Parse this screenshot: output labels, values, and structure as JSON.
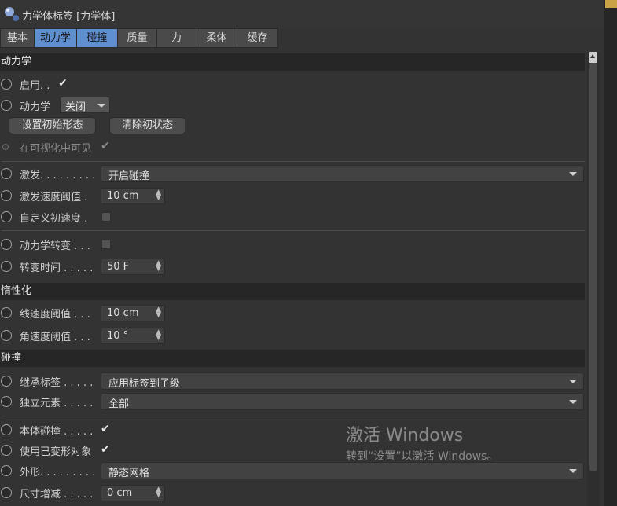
{
  "window": {
    "title": "力学体标签 [力学体]"
  },
  "tabs": [
    {
      "label": "基本",
      "active": false
    },
    {
      "label": "动力学",
      "active": true
    },
    {
      "label": "碰撞",
      "active": true
    },
    {
      "label": "质量",
      "active": false
    },
    {
      "label": "力",
      "active": false
    },
    {
      "label": "柔体",
      "active": false
    },
    {
      "label": "缓存",
      "active": false
    }
  ],
  "sections": {
    "dynamics": "动力学",
    "inertia": "惰性化",
    "collision": "碰撞"
  },
  "dynamics": {
    "enable_label": "启用. .",
    "enable_checked": true,
    "dynamics_label": "动力学",
    "dynamics_value": "关闭",
    "set_initial_button": "设置初始形态",
    "clear_initial_button": "清除初状态",
    "visible_label": "在可视化中可见",
    "visible_checked": true,
    "trigger_label": "激发. . . . . . . . .",
    "trigger_value": "开启碰撞",
    "trigger_speed_label": "激发速度阈值 .",
    "trigger_speed_value": "10 cm",
    "custom_init_label": "自定义初速度 .",
    "custom_init_checked": false,
    "dyn_transition_label": "动力学转变 . . .",
    "dyn_transition_checked": false,
    "transition_time_label": "转变时间 . . . . .",
    "transition_time_value": "50 F"
  },
  "inertia": {
    "linear_label": "线速度阈值 . . .",
    "linear_value": "10 cm",
    "angular_label": "角速度阈值 . . .",
    "angular_value": "10 °"
  },
  "collision": {
    "inherit_label": "继承标签 . . . . .",
    "inherit_value": "应用标签到子级",
    "independent_label": "独立元素 . . . . .",
    "independent_value": "全部",
    "self_collision_label": "本体碰撞 . . . . .",
    "self_collision_checked": true,
    "deformed_label": "使用已变形对象",
    "deformed_checked": true,
    "shape_label": "外形. . . . . . . . .",
    "shape_value": "静态网格",
    "size_label": "尺寸增减 . . . . .",
    "size_value": "0 cm"
  },
  "icons": {
    "check": "✔"
  },
  "watermark": {
    "line1": "激活 Windows",
    "line2": "转到“设置”以激活 Windows。"
  },
  "colors": {
    "active_tab": "#5f8fcf",
    "background": "#333333",
    "header": "#262626"
  }
}
